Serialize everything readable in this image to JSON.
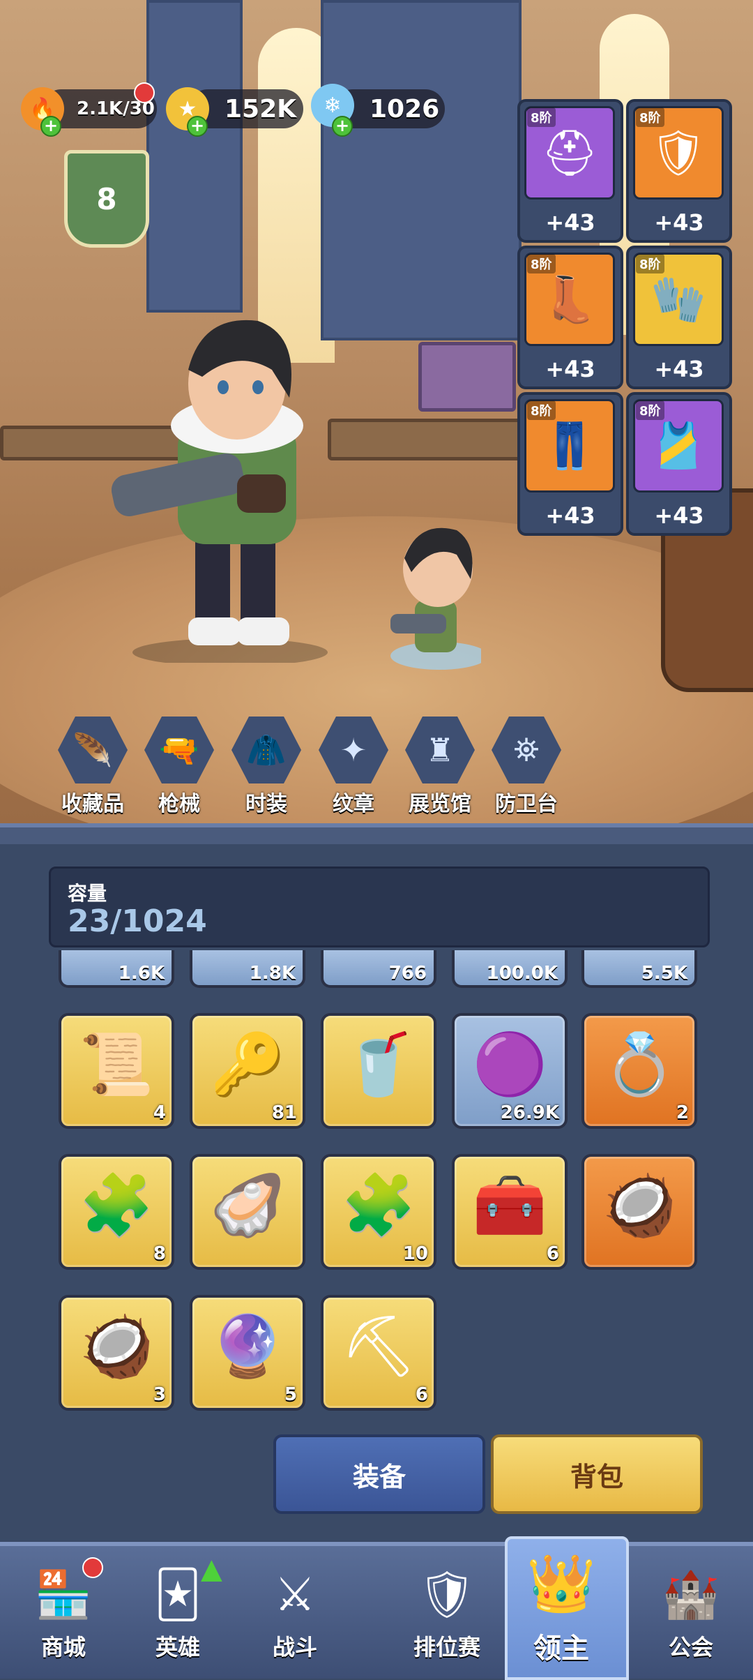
{
  "resources": [
    {
      "name": "fire",
      "icon": "🔥",
      "value": "2.1K/30"
    },
    {
      "name": "gold",
      "icon": "★",
      "value": "152K"
    },
    {
      "name": "crystal",
      "icon": "❄",
      "value": "1026"
    }
  ],
  "level": "8",
  "equipment": [
    {
      "tier": "8阶",
      "bonus": "+43",
      "icon": "⛑",
      "color": "#9b5cd6"
    },
    {
      "tier": "8阶",
      "bonus": "+43",
      "icon": "🛡",
      "color": "#f08a2e"
    },
    {
      "tier": "8阶",
      "bonus": "+43",
      "icon": "👢",
      "color": "#f08a2e"
    },
    {
      "tier": "8阶",
      "bonus": "+43",
      "icon": "🧤",
      "color": "#f0c23a"
    },
    {
      "tier": "8阶",
      "bonus": "+43",
      "icon": "👖",
      "color": "#f08a2e"
    },
    {
      "tier": "8阶",
      "bonus": "+43",
      "icon": "🎽",
      "color": "#9b5cd6"
    }
  ],
  "categories": [
    {
      "label": "收藏品",
      "icon": "🪶"
    },
    {
      "label": "枪械",
      "icon": "🔫"
    },
    {
      "label": "时装",
      "icon": "🧥"
    },
    {
      "label": "纹章",
      "icon": "✦"
    },
    {
      "label": "展览馆",
      "icon": "♜"
    },
    {
      "label": "防卫台",
      "icon": "⛯"
    }
  ],
  "capacity": {
    "label": "容量",
    "value": "23/1024"
  },
  "partial_row": [
    "1.6K",
    "1.8K",
    "766",
    "100.0K",
    "5.5K"
  ],
  "items": [
    {
      "icon": "📜",
      "count": "4",
      "bg": "gold"
    },
    {
      "icon": "🔑",
      "count": "81",
      "bg": "gold"
    },
    {
      "icon": "🥤",
      "count": "",
      "bg": "gold"
    },
    {
      "icon": "🟣",
      "count": "26.9K",
      "bg": "blue"
    },
    {
      "icon": "💍",
      "count": "2",
      "bg": "orange"
    },
    {
      "icon": "🧩",
      "count": "8",
      "bg": "gold"
    },
    {
      "icon": "🦪",
      "count": "",
      "bg": "gold"
    },
    {
      "icon": "🧩",
      "count": "10",
      "bg": "gold"
    },
    {
      "icon": "🧰",
      "count": "6",
      "bg": "gold"
    },
    {
      "icon": "🥥",
      "count": "",
      "bg": "orange"
    },
    {
      "icon": "🥥",
      "count": "3",
      "bg": "gold"
    },
    {
      "icon": "🔮",
      "count": "5",
      "bg": "gold"
    },
    {
      "icon": "⛏",
      "count": "6",
      "bg": "gold"
    }
  ],
  "buttons": {
    "equip": "装备",
    "bag": "背包"
  },
  "nav": [
    {
      "label": "商城",
      "icon": "🏪"
    },
    {
      "label": "英雄",
      "icon": "🃏"
    },
    {
      "label": "战斗",
      "icon": "⚔"
    },
    {
      "label": "排位赛",
      "icon": "🛡"
    },
    {
      "label": "领主",
      "icon": "👑"
    },
    {
      "label": "公会",
      "icon": "🏰"
    }
  ]
}
